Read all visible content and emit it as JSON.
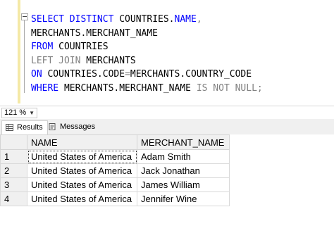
{
  "editor": {
    "lines": [
      [
        {
          "t": "SELECT DISTINCT ",
          "c": "kw"
        },
        {
          "t": "COUNTRIES.",
          "c": ""
        },
        {
          "t": "NAME",
          "c": "kw"
        },
        {
          "t": ",",
          "c": "gray"
        }
      ],
      [
        {
          "t": "MERCHANTS.MERCHANT_NAME",
          "c": ""
        }
      ],
      [
        {
          "t": "FROM ",
          "c": "kw"
        },
        {
          "t": "COUNTRIES",
          "c": ""
        }
      ],
      [
        {
          "t": "LEFT JOIN ",
          "c": "gray"
        },
        {
          "t": "MERCHANTS",
          "c": ""
        }
      ],
      [
        {
          "t": "ON ",
          "c": "kw"
        },
        {
          "t": "COUNTRIES.CODE",
          "c": ""
        },
        {
          "t": "=",
          "c": "gray"
        },
        {
          "t": "MERCHANTS.COUNTRY_CODE",
          "c": ""
        }
      ],
      [
        {
          "t": "WHERE ",
          "c": "kw"
        },
        {
          "t": "MERCHANTS.MERCHANT_NAME ",
          "c": ""
        },
        {
          "t": "IS NOT NULL",
          "c": "gray"
        },
        {
          "t": ";",
          "c": "gray"
        }
      ]
    ]
  },
  "zoom": {
    "value": "121 %"
  },
  "tabs": {
    "results": "Results",
    "messages": "Messages"
  },
  "results": {
    "columns": [
      "NAME",
      "MERCHANT_NAME"
    ],
    "rows": [
      {
        "n": "1",
        "name": "United States of America",
        "merchant": "Adam Smith"
      },
      {
        "n": "2",
        "name": "United States of America",
        "merchant": "Jack Jonathan"
      },
      {
        "n": "3",
        "name": "United States of America",
        "merchant": "James William"
      },
      {
        "n": "4",
        "name": "United States of America",
        "merchant": "Jennifer Wine"
      }
    ]
  }
}
